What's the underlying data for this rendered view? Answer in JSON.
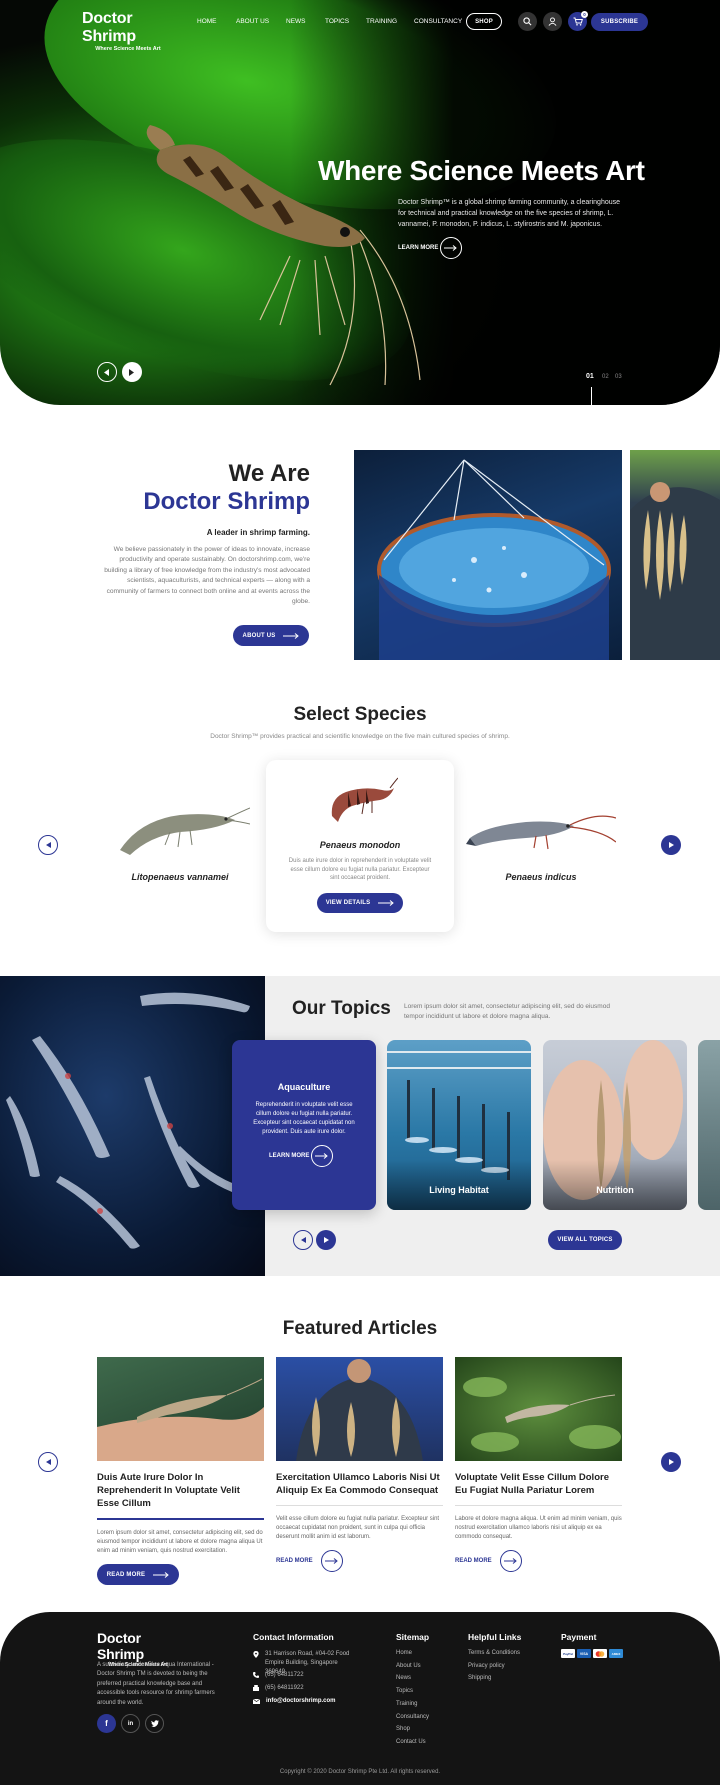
{
  "brand": {
    "name": "Doctor Shrimp",
    "tagline": "Where Science Meets Art"
  },
  "nav": {
    "items": [
      "HOME",
      "ABOUT US",
      "NEWS",
      "TOPICS",
      "TRAINING",
      "CONSULTANCY"
    ],
    "shop": "SHOP",
    "subscribe": "SUBSCRIBE",
    "cart_count": "0"
  },
  "hero": {
    "title": "Where Science Meets Art",
    "description": "Doctor Shrimp™ is a global shrimp farming community, a clearinghouse for technical and practical knowledge on the five species of shrimp, L. vannamei, P. monodon, P. indicus, L. stylirostris and M. japonicus.",
    "cta": "LEARN MORE",
    "slides": [
      "01",
      "02",
      "03"
    ],
    "active_slide": "01"
  },
  "about": {
    "heading_line1": "We Are",
    "heading_line2": "Doctor Shrimp",
    "lead": "A leader in shrimp farming.",
    "body": "We believe passionately in the power of ideas to innovate, increase productivity and operate sustainably. On doctorshrimp.com, we're building a library of free knowledge from the industry's most advocated scientists, aquaculturists, and technical experts — along with a community of farmers to connect both online and at events across the globe.",
    "button": "ABOUT US"
  },
  "species": {
    "heading": "Select Species",
    "subtitle": "Doctor Shrimp™ provides practical and scientific knowledge on the five main cultured species of shrimp.",
    "items": [
      {
        "name": "Litopenaeus vannamei"
      },
      {
        "name": "Penaeus monodon",
        "text": "Duis aute irure dolor in reprehenderit in voluptate velit esse cillum dolore eu fugiat nulla pariatur. Excepteur sint occaecat proident.",
        "button": "VIEW DETAILS"
      },
      {
        "name": "Penaeus indicus"
      }
    ]
  },
  "topics": {
    "heading": "Our Topics",
    "intro": "Lorem ipsum dolor sit amet, consectetur adipiscing elit, sed do eiusmod tempor incididunt ut labore et dolore magna aliqua.",
    "active": {
      "title": "Aquaculture",
      "text": "Reprehenderit in voluptate velit esse cillum dolore eu fugiat nulla pariatur. Excepteur sint occaecat cupidatat non provident. Duis aute irure dolor.",
      "cta": "LEARN MORE"
    },
    "cards": [
      "Living Habitat",
      "Nutrition"
    ],
    "view_all": "VIEW ALL TOPICS"
  },
  "articles": {
    "heading": "Featured Articles",
    "items": [
      {
        "title": "Duis Aute Irure Dolor In Reprehenderit In Voluptate Velit Esse Cillum",
        "text": "Lorem ipsum dolor sit amet, consectetur adipiscing elit, sed do eiusmod tempor incididunt ut labore et dolore magna aliqua Ut enim ad minim veniam, quis nostrud exercitation.",
        "cta": "READ MORE"
      },
      {
        "title": "Exercitation Ullamco Laboris Nisi Ut Aliquip Ex Ea Commodo Consequat",
        "text": "Velit esse cillum dolore eu fugiat nulla pariatur. Excepteur sint occaecat cupidatat non proident, sunt in culpa qui officia deserunt mollit anim id est laborum.",
        "cta": "READ MORE"
      },
      {
        "title": "Voluptate Velit Esse Cillum Dolore Eu Fugiat Nulla Pariatur Lorem",
        "text": "Labore et dolore magna aliqua. Ut enim ad minim veniam, quis nostrud exercitation ullamco laboris nisi ut aliquip ex ea commodo consequat.",
        "cta": "READ MORE"
      }
    ]
  },
  "footer": {
    "about": "A subsidiary under Blue Aqua International - Doctor Shrimp TM is devoted to being the preferred practical knowledge base and accessible tools resource for shrimp farmers around the world.",
    "contact_heading": "Contact Information",
    "address": "31 Harrison Road, #04-02 Food Empire Building, Singapore 369649",
    "phone1": "(65) 64811722",
    "phone2": "(65) 64811922",
    "email": "info@doctorshrimp.com",
    "sitemap_heading": "Sitemap",
    "sitemap": [
      "Home",
      "About Us",
      "News",
      "Topics",
      "Training",
      "Consultancy",
      "Shop",
      "Contact Us"
    ],
    "helpful_heading": "Helpful Links",
    "helpful": [
      "Terms & Conditions",
      "Privacy policy",
      "Shipping"
    ],
    "payment_heading": "Payment",
    "payments": [
      "PayPal",
      "VISA",
      "Mastercard",
      "Amex"
    ],
    "copyright": "Copyright © 2020 Doctor Shrimp Pte Ltd. All rights reserved."
  },
  "colors": {
    "primary": "#2c3694",
    "dark": "#141414",
    "light_bg": "#efefef"
  }
}
